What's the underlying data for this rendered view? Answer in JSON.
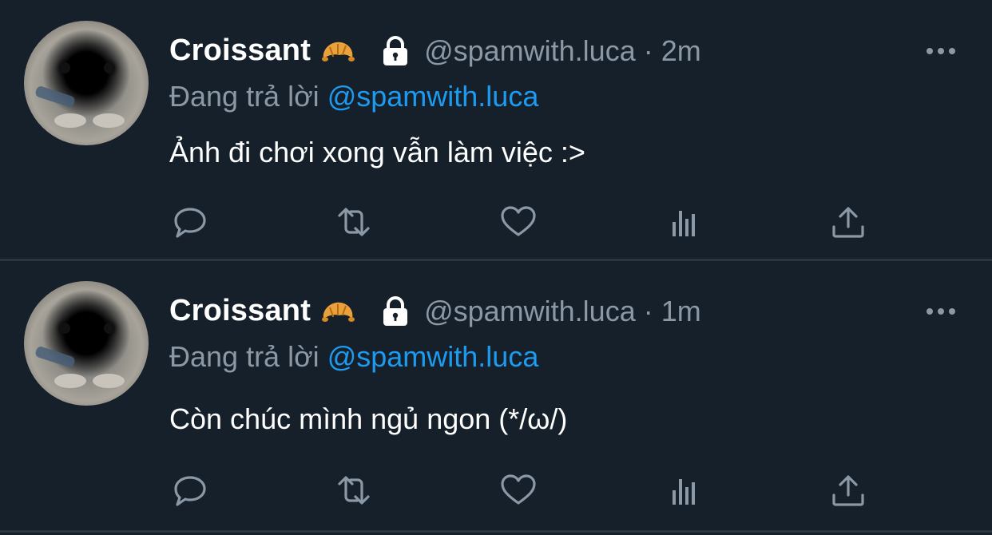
{
  "tweets": [
    {
      "display_name": "Croissant",
      "name_emoji": "croissant-emoji",
      "handle_time": "@spamwith.luca · 2m",
      "reply_prefix": "Đang trả lời",
      "reply_mention": "@spamwith.luca",
      "text": "Ảnh đi chơi xong vẫn làm việc :>"
    },
    {
      "display_name": "Croissant",
      "name_emoji": "croissant-emoji",
      "handle_time": "@spamwith.luca · 1m",
      "reply_prefix": "Đang trả lời",
      "reply_mention": "@spamwith.luca",
      "text": "Còn chúc mình ngủ ngon (*/ω/)"
    }
  ],
  "actions": [
    "reply-icon",
    "retweet-icon",
    "like-icon",
    "analytics-icon",
    "share-icon"
  ],
  "colors": {
    "background": "#15202b",
    "divider": "#2b3540",
    "muted": "#8b98a5",
    "mention": "#1d9bf0",
    "text": "#ffffff"
  }
}
